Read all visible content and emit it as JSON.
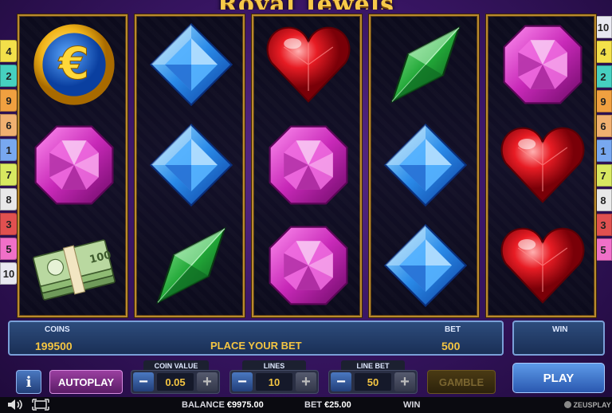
{
  "game": {
    "title": "Royal Jewels"
  },
  "paylines": {
    "left": [
      {
        "num": "4",
        "color": "#f3e04a"
      },
      {
        "num": "2",
        "color": "#46d0c0"
      },
      {
        "num": "9",
        "color": "#f0a040"
      },
      {
        "num": "6",
        "color": "#f0b070"
      },
      {
        "num": "1",
        "color": "#78a8f0"
      },
      {
        "num": "7",
        "color": "#d8e860"
      },
      {
        "num": "8",
        "color": "#e8e8e8"
      },
      {
        "num": "3",
        "color": "#e05050"
      },
      {
        "num": "5",
        "color": "#f070c8"
      },
      {
        "num": "10",
        "color": "#e8e8f0"
      }
    ],
    "right": [
      {
        "num": "10",
        "color": "#e8e8f0"
      },
      {
        "num": "4",
        "color": "#f3e04a"
      },
      {
        "num": "2",
        "color": "#46d0c0"
      },
      {
        "num": "9",
        "color": "#f0a040"
      },
      {
        "num": "6",
        "color": "#f0b070"
      },
      {
        "num": "1",
        "color": "#78a8f0"
      },
      {
        "num": "7",
        "color": "#d8e860"
      },
      {
        "num": "8",
        "color": "#e8e8e8"
      },
      {
        "num": "3",
        "color": "#e05050"
      },
      {
        "num": "5",
        "color": "#f070c8"
      }
    ]
  },
  "reels": [
    [
      "euro-coin",
      "pink-gem",
      "money-stack"
    ],
    [
      "blue-gem",
      "blue-gem",
      "green-gem"
    ],
    [
      "red-heart",
      "pink-gem",
      "pink-gem"
    ],
    [
      "green-gem",
      "blue-gem",
      "blue-gem"
    ],
    [
      "pink-gem",
      "red-heart",
      "red-heart"
    ]
  ],
  "info": {
    "coins_label": "COINS",
    "coins_value": "199500",
    "message": "PLACE YOUR BET",
    "bet_label": "BET",
    "bet_value": "500",
    "win_label": "WIN"
  },
  "controls": {
    "info_label": "i",
    "autoplay_label": "AUTOPLAY",
    "coin_value": {
      "label": "COIN VALUE",
      "value": "0.05"
    },
    "lines": {
      "label": "LINES",
      "value": "10"
    },
    "line_bet": {
      "label": "LINE BET",
      "value": "50"
    },
    "minus": "−",
    "plus": "+",
    "gamble_label": "GAMBLE",
    "play_label": "PLAY"
  },
  "status": {
    "balance_label": "BALANCE",
    "balance_value": "€9975.00",
    "bet_label": "BET",
    "bet_value": "€25.00",
    "win_label": "WIN",
    "brand": "ZEUSPLAY"
  }
}
